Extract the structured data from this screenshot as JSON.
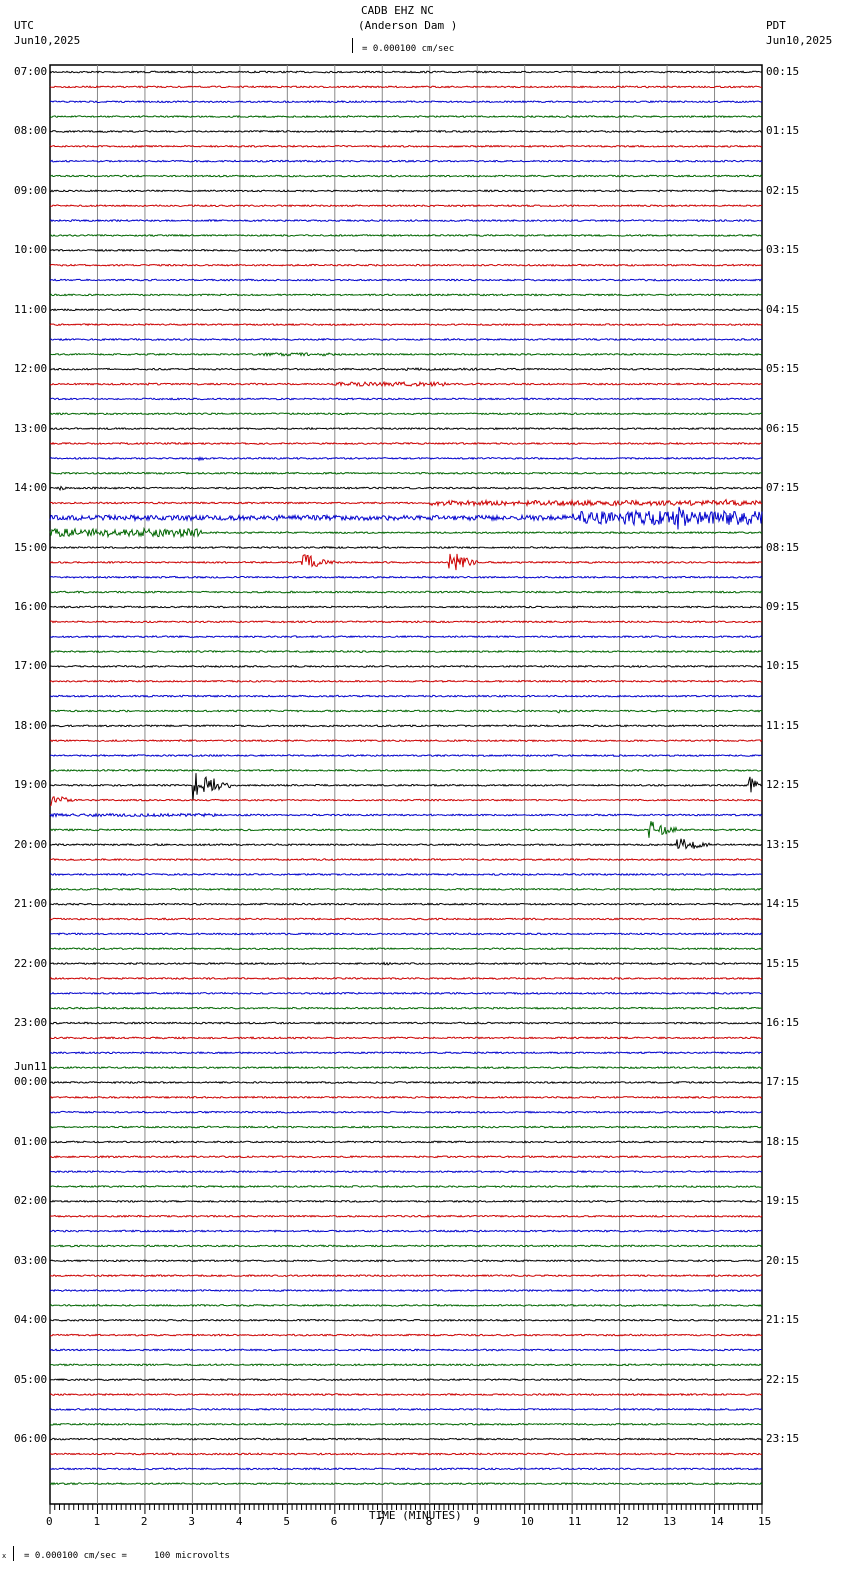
{
  "header": {
    "station": "CADB EHZ NC",
    "location": "(Anderson Dam )",
    "left_tz": "UTC",
    "left_date": "Jun10,2025",
    "right_tz": "PDT",
    "right_date": "Jun10,2025",
    "scale": "= 0.000100 cm/sec"
  },
  "footer": {
    "scale_note": "= 0.000100 cm/sec =     100 microvolts",
    "prefix": "x"
  },
  "chart_data": {
    "type": "line",
    "title": "CADB EHZ NC (Anderson Dam )",
    "xlabel": "TIME (MINUTES)",
    "xlim": [
      0,
      15
    ],
    "x_ticks": [
      "0",
      "1",
      "2",
      "3",
      "4",
      "5",
      "6",
      "7",
      "8",
      "9",
      "10",
      "11",
      "12",
      "13",
      "14",
      "15"
    ],
    "traces_per_hour": 4,
    "trace_colors": [
      "#000000",
      "#cc0000",
      "#0000cc",
      "#006600"
    ],
    "left_labels": [
      "07:00",
      "08:00",
      "09:00",
      "10:00",
      "11:00",
      "12:00",
      "13:00",
      "14:00",
      "15:00",
      "16:00",
      "17:00",
      "18:00",
      "19:00",
      "20:00",
      "21:00",
      "22:00",
      "23:00",
      "00:00",
      "01:00",
      "02:00",
      "03:00",
      "04:00",
      "05:00",
      "06:00"
    ],
    "date_change_label": "Jun11",
    "right_labels": [
      "00:15",
      "01:15",
      "02:15",
      "03:15",
      "04:15",
      "05:15",
      "06:15",
      "07:15",
      "08:15",
      "09:15",
      "10:15",
      "11:15",
      "12:15",
      "13:15",
      "14:15",
      "15:15",
      "16:15",
      "17:15",
      "18:15",
      "19:15",
      "20:15",
      "21:15",
      "22:15",
      "23:15"
    ],
    "events": [
      {
        "trace": 19,
        "start": 4.5,
        "end": 6.2,
        "amp": 1.5
      },
      {
        "trace": 20,
        "start": 7,
        "end": 9,
        "amp": 1.2
      },
      {
        "trace": 21,
        "start": 6,
        "end": 8.5,
        "amp": 2
      },
      {
        "trace": 21,
        "start": 2,
        "end": 3,
        "amp": 1.2
      },
      {
        "trace": 26,
        "start": 3.1,
        "end": 3.4,
        "amp": 3
      },
      {
        "trace": 28,
        "start": 0.2,
        "end": 0.4,
        "amp": 3
      },
      {
        "trace": 29,
        "start": 8,
        "end": 15,
        "amp": 2.5
      },
      {
        "trace": 29,
        "start": 14.2,
        "end": 14.4,
        "amp": 5
      },
      {
        "trace": 30,
        "start": 0,
        "end": 11,
        "amp": 2.5
      },
      {
        "trace": 30,
        "start": 11,
        "end": 15,
        "amp": 7
      },
      {
        "trace": 30,
        "start": 13.2,
        "end": 13.7,
        "amp": 14
      },
      {
        "trace": 31,
        "start": 0,
        "end": 3.2,
        "amp": 4
      },
      {
        "trace": 33,
        "start": 5.3,
        "end": 6,
        "amp": 9
      },
      {
        "trace": 33,
        "start": 8.4,
        "end": 9,
        "amp": 12
      },
      {
        "trace": 43,
        "start": 10.7,
        "end": 10.9,
        "amp": 4
      },
      {
        "trace": 48,
        "start": 3,
        "end": 3.8,
        "amp": 16
      },
      {
        "trace": 48,
        "start": 14.7,
        "end": 15,
        "amp": 10
      },
      {
        "trace": 49,
        "start": 0,
        "end": 0.6,
        "amp": 6
      },
      {
        "trace": 50,
        "start": 0,
        "end": 3.5,
        "amp": 1.5
      },
      {
        "trace": 51,
        "start": 12.6,
        "end": 13.2,
        "amp": 12
      },
      {
        "trace": 52,
        "start": 13.2,
        "end": 13.9,
        "amp": 9
      },
      {
        "trace": 60,
        "start": 7,
        "end": 7.4,
        "amp": 2
      }
    ]
  }
}
